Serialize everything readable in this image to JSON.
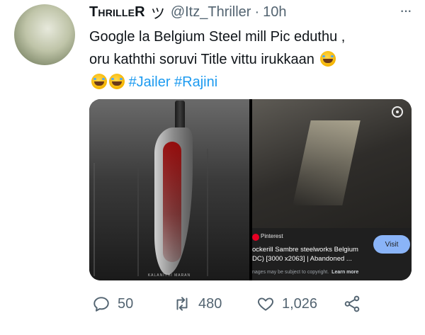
{
  "tweet": {
    "display_name": "ThrilleR",
    "verified_glyph": "ツ",
    "handle": "@Itz_Thriller",
    "separator": "·",
    "time": "10h",
    "more_glyph": "···",
    "text": {
      "line1": "Google la Belgium Steel mill Pic eduthu ,",
      "line2": "oru kaththi soruvi Title vittu irukkaan",
      "hashtags": [
        "#Jailer",
        "#Rajini"
      ]
    }
  },
  "media": {
    "left_image": {
      "credit": "KALANITHI MARAN"
    },
    "right_image": {
      "source": "Pinterest",
      "title_line1": "ockerill Sambre steelworks Belgium",
      "title_line2": "DC) [3000 x2063] | Abandoned ...",
      "note": "nages may be subject to copyright.",
      "learn_more": "Learn more",
      "visit_label": "Visit"
    }
  },
  "actions": {
    "reply_count": "50",
    "retweet_count": "480",
    "like_count": "1,026"
  },
  "icons": {
    "reply": "reply-icon",
    "retweet": "retweet-icon",
    "like": "heart-icon",
    "share": "share-icon",
    "emoji": "rofl-emoji",
    "lens": "lens-icon",
    "pinterest": "pinterest-icon"
  },
  "colors": {
    "hashtag": "#1d9bf0",
    "muted": "#536471",
    "visit_button": "#8ab4f8"
  }
}
